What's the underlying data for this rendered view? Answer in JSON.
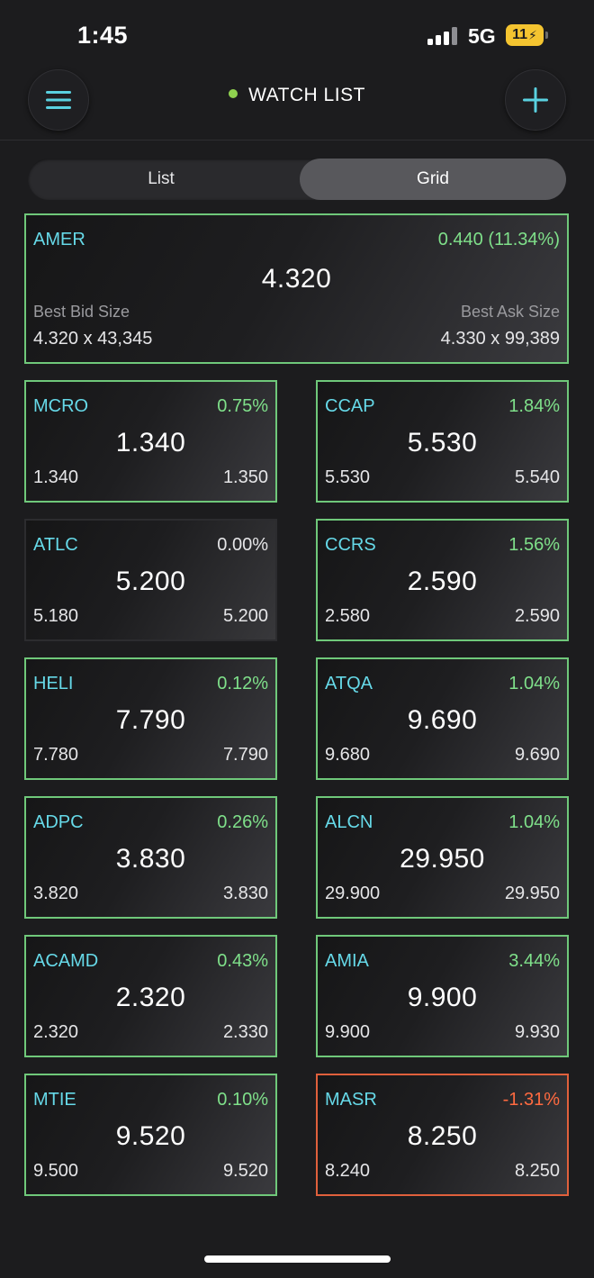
{
  "status_bar": {
    "time": "1:45",
    "network": "5G",
    "battery": "11"
  },
  "header": {
    "title": "WATCH LIST"
  },
  "view_toggle": {
    "list_label": "List",
    "grid_label": "Grid",
    "selected": "Grid"
  },
  "featured": {
    "symbol": "AMER",
    "change": "0.440  (11.34%)",
    "price": "4.320",
    "bid_label": "Best Bid Size",
    "ask_label": "Best Ask Size",
    "bid": "4.320  x  43,345",
    "ask": "4.330  x  99,389"
  },
  "tiles": [
    {
      "symbol": "MCRO",
      "change": "0.75%",
      "price": "1.340",
      "bid": "1.340",
      "ask": "1.350",
      "trend": "up"
    },
    {
      "symbol": "CCAP",
      "change": "1.84%",
      "price": "5.530",
      "bid": "5.530",
      "ask": "5.540",
      "trend": "up"
    },
    {
      "symbol": "ATLC",
      "change": "0.00%",
      "price": "5.200",
      "bid": "5.180",
      "ask": "5.200",
      "trend": "flat"
    },
    {
      "symbol": "CCRS",
      "change": "1.56%",
      "price": "2.590",
      "bid": "2.580",
      "ask": "2.590",
      "trend": "up"
    },
    {
      "symbol": "HELI",
      "change": "0.12%",
      "price": "7.790",
      "bid": "7.780",
      "ask": "7.790",
      "trend": "up"
    },
    {
      "symbol": "ATQA",
      "change": "1.04%",
      "price": "9.690",
      "bid": "9.680",
      "ask": "9.690",
      "trend": "up"
    },
    {
      "symbol": "ADPC",
      "change": "0.26%",
      "price": "3.830",
      "bid": "3.820",
      "ask": "3.830",
      "trend": "up"
    },
    {
      "symbol": "ALCN",
      "change": "1.04%",
      "price": "29.950",
      "bid": "29.900",
      "ask": "29.950",
      "trend": "up"
    },
    {
      "symbol": "ACAMD",
      "change": "0.43%",
      "price": "2.320",
      "bid": "2.320",
      "ask": "2.330",
      "trend": "up"
    },
    {
      "symbol": "AMIA",
      "change": "3.44%",
      "price": "9.900",
      "bid": "9.900",
      "ask": "9.930",
      "trend": "up"
    },
    {
      "symbol": "MTIE",
      "change": "0.10%",
      "price": "9.520",
      "bid": "9.500",
      "ask": "9.520",
      "trend": "up"
    },
    {
      "symbol": "MASR",
      "change": "-1.31%",
      "price": "8.250",
      "bid": "8.240",
      "ask": "8.250",
      "trend": "down"
    }
  ],
  "colors": {
    "up": "#6fc87a",
    "down": "#e0603c",
    "symbol": "#66d9e8",
    "accent": "#5ad1e0",
    "live": "#8fd14f"
  },
  "icons": {
    "menu": "hamburger-icon",
    "add": "plus-icon",
    "live": "live-dot-icon"
  }
}
